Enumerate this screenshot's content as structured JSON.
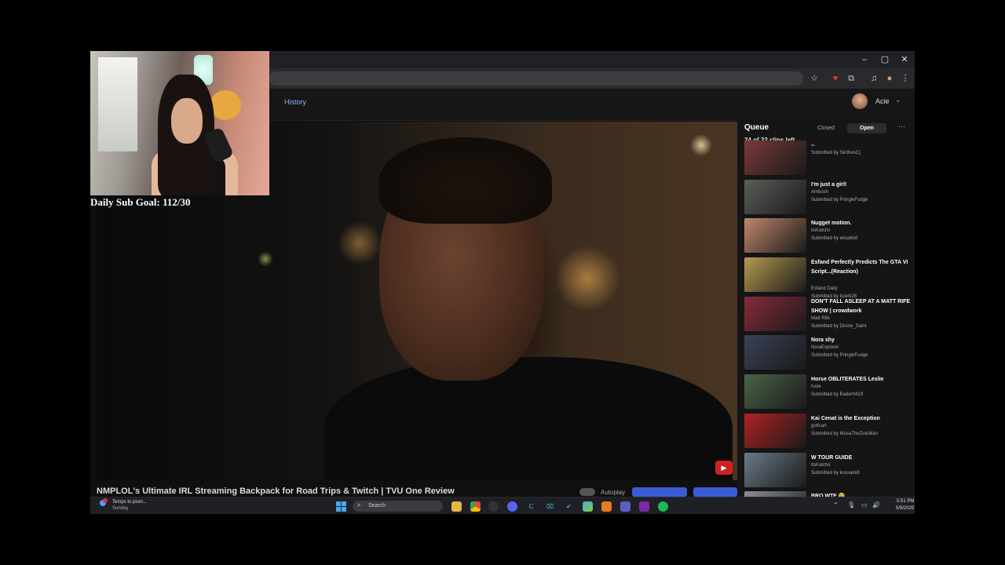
{
  "browser": {
    "window_controls": {
      "minimize": "–",
      "maximize": "▢",
      "close": "✕"
    }
  },
  "header": {
    "nav_link": "History",
    "user_name": "Acie"
  },
  "overlay": {
    "sub_goal": "Daily Sub Goal: 112/30"
  },
  "video": {
    "title": "NMPLOL's Ultimate IRL Streaming Backpack for Road Trips & Twitch | TVU One Review",
    "autoplay_label": "Autoplay"
  },
  "queue": {
    "title": "Queue",
    "tab_closed": "Closed",
    "tab_open": "Open",
    "count_text": "24 of 32 clips left",
    "items": [
      {
        "title": "--",
        "channel": "",
        "submitter": "Submitted by SinthesC]",
        "color": "#7a3a3a"
      },
      {
        "title": "I'm just a girl!",
        "channel": "Ambush",
        "submitter": "Submitted by PringleFudge",
        "color": "#5a5e58"
      },
      {
        "title": "Nugget motion.",
        "channel": "itsKatchii",
        "submitter": "Submitted by ekoplold",
        "color": "#c0876c"
      },
      {
        "title": "Esfand Perfectly Predicts The GTA VI Script...(Reaction)",
        "channel": "Esfand Daily",
        "submitter": "Submitted by bzerk26",
        "color": "#b49a50"
      },
      {
        "title": "DON'T FALL ASLEEP AT A MATT RIFE SHOW | crowdwork",
        "channel": "Matt Rife",
        "submitter": "Submitted by Divine_Saint",
        "color": "#8a2a3a"
      },
      {
        "title": "Nora shy",
        "channel": "NoraExplorer",
        "submitter": "Submitted by PringleFudge",
        "color": "#3a4258"
      },
      {
        "title": "Horse OBLITERATES Leslie",
        "channel": "fusle",
        "submitter": "Submitted by Bader0419",
        "color": "#4a6448"
      },
      {
        "title": "Kai Cenat is the Exception",
        "channel": "golfcart",
        "submitter": "Submitted by MusaTheZuluMan",
        "color": "#b02222"
      },
      {
        "title": "W TOUR GUIDE",
        "channel": "itsKatchii",
        "submitter": "Submitted by kossaini8",
        "color": "#6a7a88"
      },
      {
        "title": "BRO WTF 😭",
        "channel": "",
        "submitter": "",
        "color": "#8a8f96"
      }
    ]
  },
  "taskbar": {
    "weather_line1": "Temps to plum...",
    "weather_line2": "Sunday",
    "search_label": "Search",
    "time": "5:51 PM",
    "date": "5/9/2025"
  }
}
